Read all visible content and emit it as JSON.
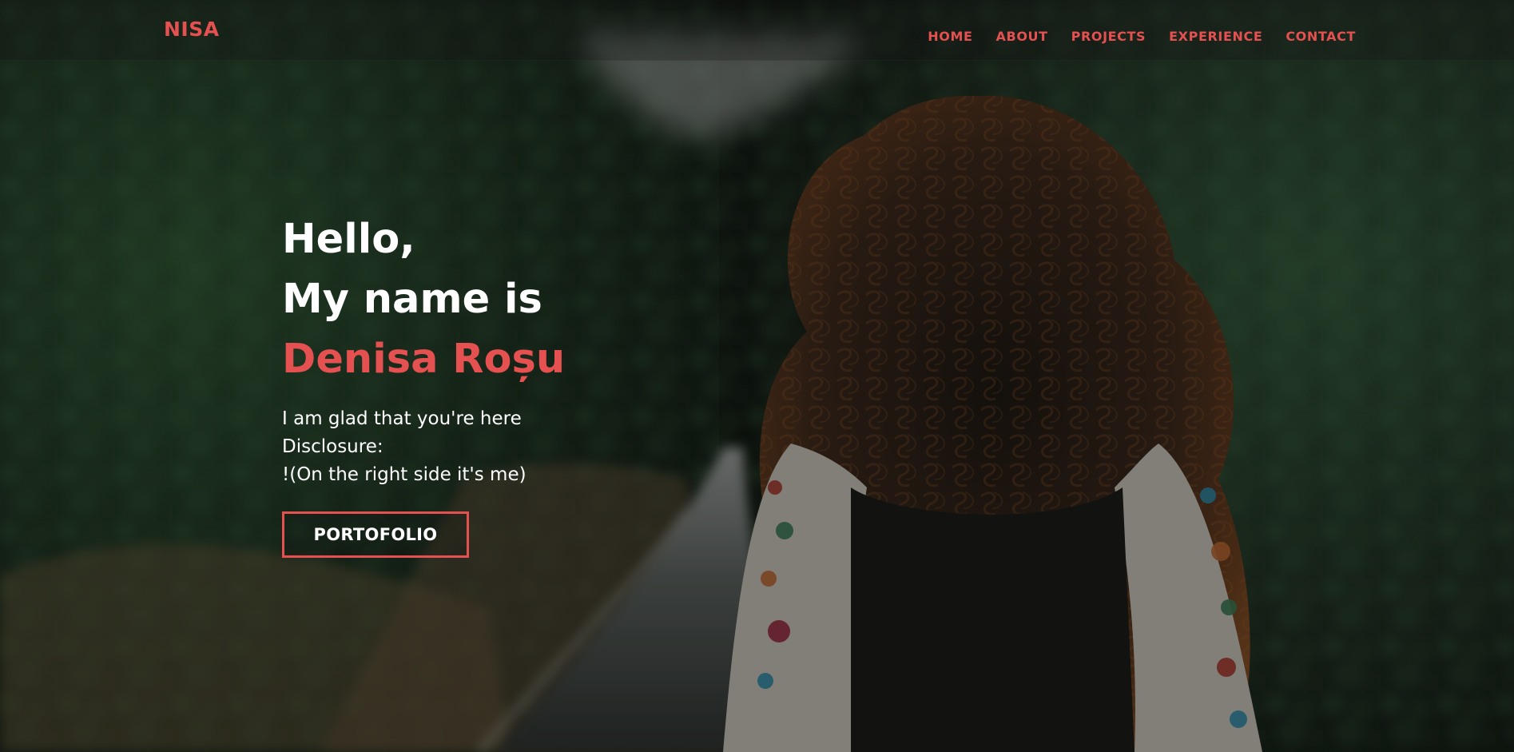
{
  "brand": {
    "name": "NISA",
    "color": "#e55050"
  },
  "navigation": [
    {
      "label": "HOME"
    },
    {
      "label": "ABOUT"
    },
    {
      "label": "PROJECTS"
    },
    {
      "label": "EXPERIENCE"
    },
    {
      "label": "CONTACT"
    }
  ],
  "hero": {
    "greeting": "Hello,",
    "intro": "My name is",
    "full_name": "Denisa Roșu",
    "message": "I am glad that you're here",
    "disclosure": "Disclosure:",
    "note": "!(On the right side it's me)",
    "button_label": "PORTOFOLIO",
    "accent_color": "#e55050"
  },
  "background": {
    "scene": "person-with-curly-hair-on-forest-road"
  }
}
